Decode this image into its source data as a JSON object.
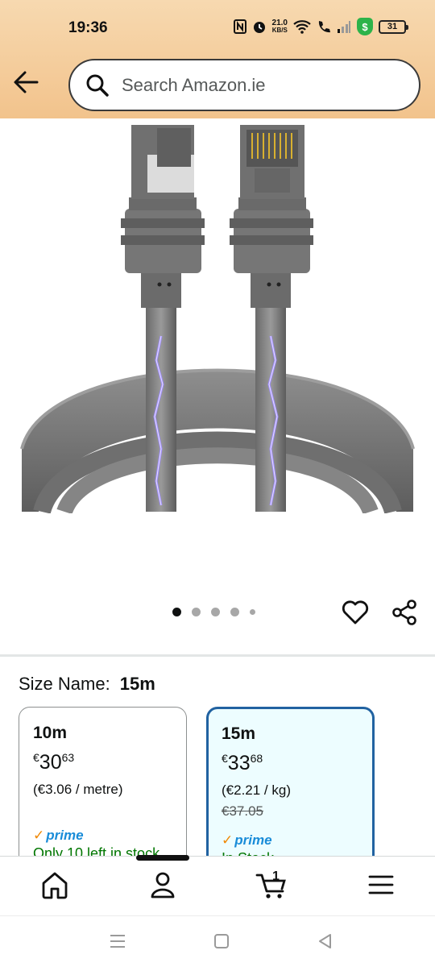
{
  "status_bar": {
    "time": "19:36",
    "speed_value": "21.0",
    "speed_unit": "KB/S",
    "battery": "31",
    "icons": [
      "nfc-icon",
      "alarm-icon",
      "wifi-icon",
      "call-icon",
      "signal-icon",
      "shield-icon",
      "battery-icon"
    ]
  },
  "header": {
    "search_placeholder": "Search Amazon.ie"
  },
  "product": {
    "image_description_icon": "ethernet-cable-image",
    "carousel": {
      "count": 5,
      "active": 0
    }
  },
  "size": {
    "label": "Size Name:",
    "selected": "15m",
    "options": [
      {
        "name": "10m",
        "currency": "€",
        "whole": "30",
        "fraction": "63",
        "unit_price": "(€3.06 / metre)",
        "was_price": "",
        "prime": "prime",
        "stock": "Only 10 left in stock",
        "selected": false
      },
      {
        "name": "15m",
        "currency": "€",
        "whole": "33",
        "fraction": "68",
        "unit_price": "(€2.21 / kg)",
        "was_price": "€37.05",
        "prime": "prime",
        "stock": "In Stock",
        "selected": true
      }
    ]
  },
  "bottom_nav": {
    "cart_count": "1",
    "items": [
      "home-icon",
      "account-icon",
      "cart-icon",
      "menu-icon"
    ]
  },
  "colors": {
    "header_top": "#f7d9b0",
    "header_bottom": "#f2c38c",
    "selected_border": "#2162a1",
    "prime_blue": "#1a8cd8",
    "stock_green": "#007600"
  }
}
